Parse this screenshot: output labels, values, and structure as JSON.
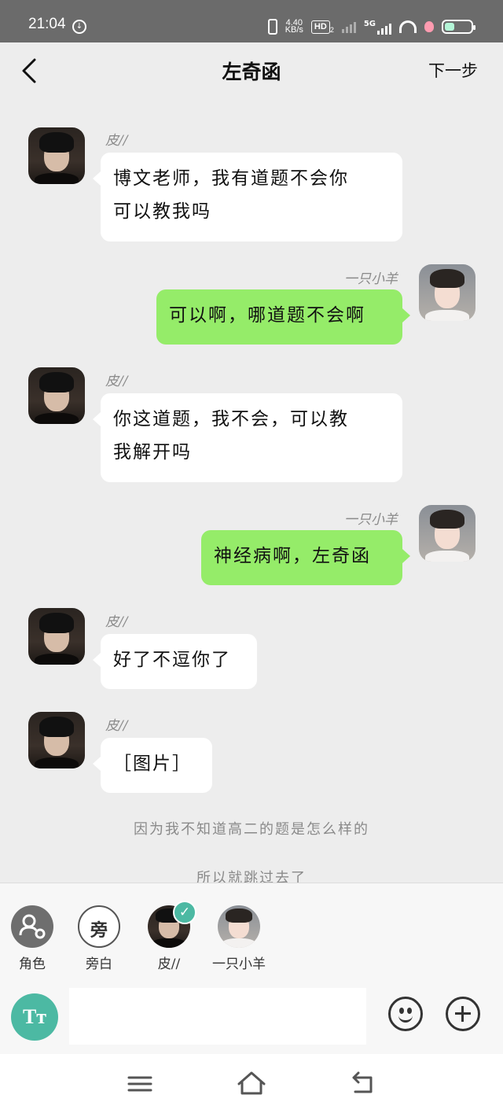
{
  "status": {
    "time": "21:04",
    "speed_top": "4.40",
    "speed_unit": "KB/s",
    "hd": "HD",
    "hd_sub": "2",
    "network": "5G"
  },
  "header": {
    "title": "左奇函",
    "next": "下一步"
  },
  "messages": [
    {
      "side": "left",
      "name": "皮//",
      "text_lines": [
        "博文老师，我有道题不会你",
        "可以教我吗"
      ]
    },
    {
      "side": "right",
      "name": "一只小羊",
      "text_lines": [
        "可以啊，哪道题不会啊"
      ]
    },
    {
      "side": "left",
      "name": "皮//",
      "text_lines": [
        "你这道题，我不会，可以教",
        "我解开吗"
      ]
    },
    {
      "side": "right",
      "name": "一只小羊",
      "text_lines": [
        "神经病啊，左奇函"
      ]
    },
    {
      "side": "left",
      "name": "皮//",
      "text_lines": [
        "好了不逗你了"
      ]
    },
    {
      "side": "left",
      "name": "皮//",
      "text_lines": [
        "［图片］"
      ]
    }
  ],
  "narration": [
    "因为我不知道高二的题是怎么样的",
    "所以就跳过去了"
  ],
  "panel": {
    "roles": [
      {
        "label": "角色",
        "glyph": "👤"
      },
      {
        "label": "旁白",
        "glyph": "旁"
      },
      {
        "label": "皮//",
        "glyph": ""
      },
      {
        "label": "一只小羊",
        "glyph": ""
      }
    ],
    "tt_label": "Tт",
    "input_value": "",
    "check": "✓"
  },
  "colors": {
    "accent": "#4cb9a3",
    "bubble_green": "#95ec69",
    "background": "#ededed"
  }
}
